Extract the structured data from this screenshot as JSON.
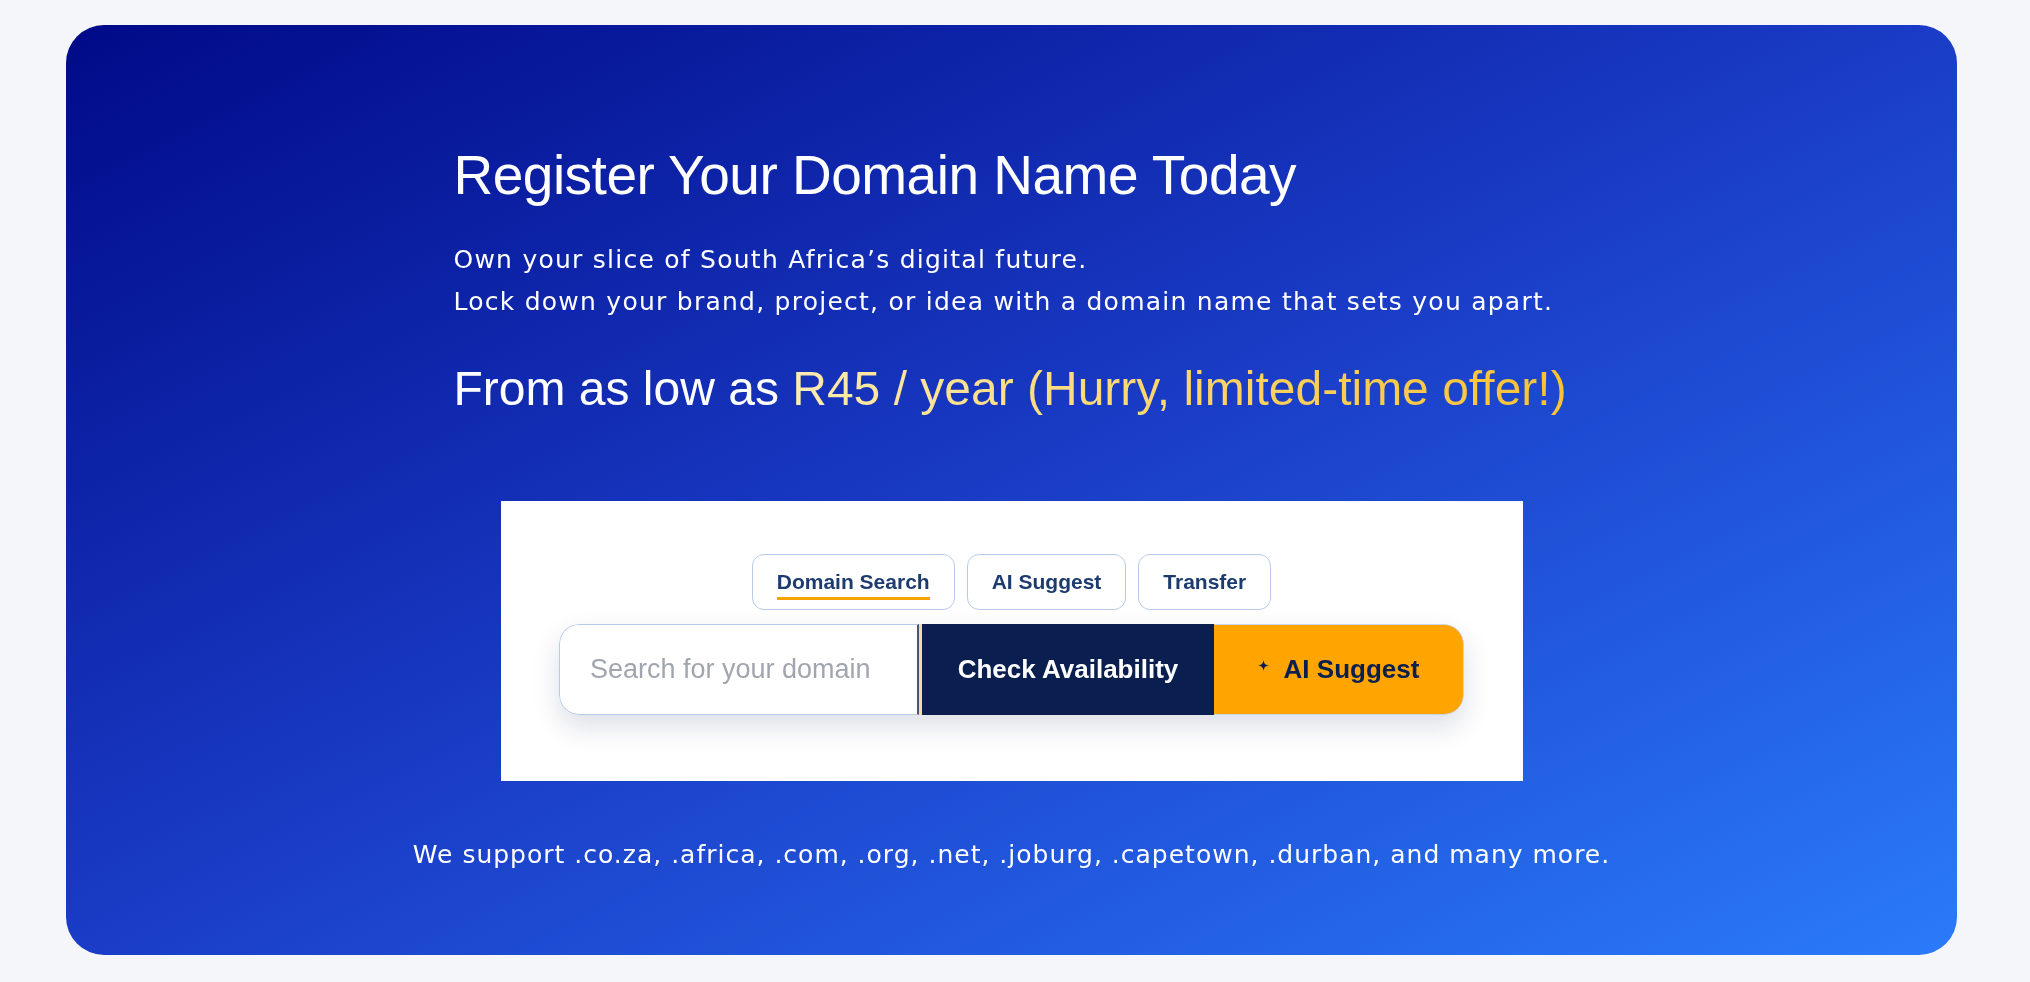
{
  "hero": {
    "title": "Register Your Domain Name Today",
    "subtitle_lines": [
      "Own your slice of South Africa’s digital future.",
      "Lock down your brand, project, or idea with a domain name that sets you apart."
    ],
    "price": {
      "lead": "From as low as",
      "offer": "R45 / year (Hurry, limited-time offer!)"
    }
  },
  "search_panel": {
    "tabs": [
      {
        "label": "Domain Search",
        "selected": true
      },
      {
        "label": "AI Suggest",
        "selected": false
      },
      {
        "label": "Transfer",
        "selected": false
      }
    ],
    "search": {
      "placeholder": "Search for your domain"
    },
    "buttons": [
      {
        "kind": "primary",
        "label": "Check Availability"
      },
      {
        "kind": "accent",
        "label": "AI Suggest"
      }
    ]
  },
  "footnote": "We support .co.za, .africa, .com, .org, .net, .joburg, .capetown, .durban, and many more."
}
